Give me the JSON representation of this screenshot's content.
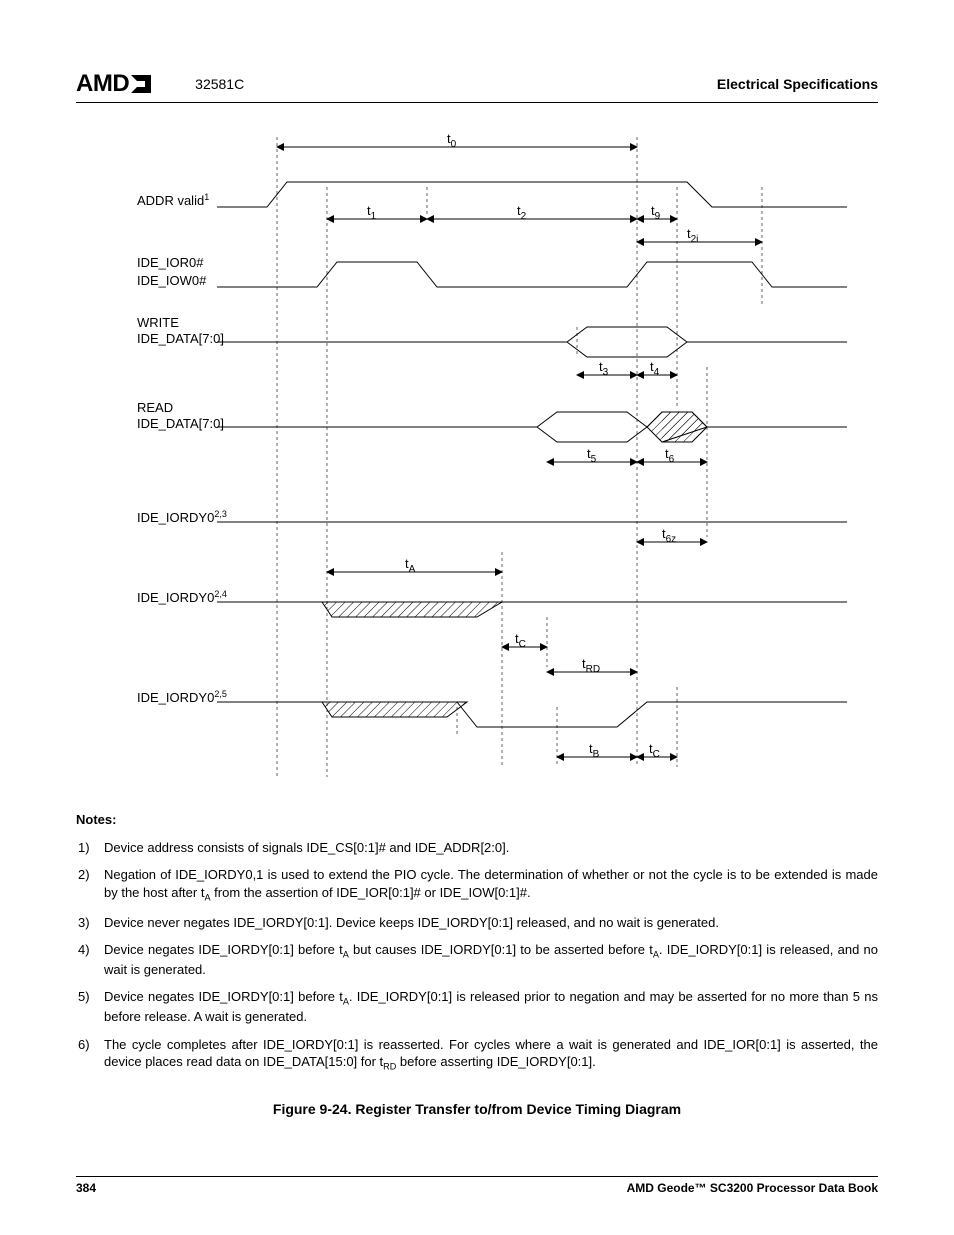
{
  "header": {
    "logo_text": "AMD",
    "doc_code": "32581C",
    "section": "Electrical Specifications"
  },
  "diagram": {
    "signals": {
      "addr": "ADDR valid",
      "addr_sup": "1",
      "ior": "IDE_IOR0#",
      "iow": "IDE_IOW0#",
      "write": "WRITE",
      "write_data": "IDE_DATA[7:0]",
      "read": "READ",
      "read_data": "IDE_DATA[7:0]",
      "iordy_a": "IDE_IORDY0",
      "iordy_a_sup": "2,3",
      "iordy_b": "IDE_IORDY0",
      "iordy_b_sup": "2,4",
      "iordy_c": "IDE_IORDY0",
      "iordy_c_sup": "2,5"
    },
    "timing": {
      "t0": "t",
      "t0_sub": "0",
      "t1": "t",
      "t1_sub": "1",
      "t2": "t",
      "t2_sub": "2",
      "t2i": "t",
      "t2i_sub": "2i",
      "t3": "t",
      "t3_sub": "3",
      "t4": "t",
      "t4_sub": "4",
      "t5": "t",
      "t5_sub": "5",
      "t6": "t",
      "t6_sub": "6",
      "t6z": "t",
      "t6z_sub": "6z",
      "t9": "t",
      "t9_sub": "9",
      "tA": "t",
      "tA_sub": "A",
      "tB": "t",
      "tB_sub": "B",
      "tC": "t",
      "tC_sub": "C",
      "tRD": "t",
      "tRD_sub": "RD"
    }
  },
  "notes": {
    "heading": "Notes:",
    "items": [
      "Device address consists of signals IDE_CS[0:1]# and IDE_ADDR[2:0].",
      "Negation of IDE_IORDY0,1 is used to extend the PIO cycle. The determination of whether or not the cycle is to be extended is made by the host after t<sub>A</sub> from the assertion of IDE_IOR[0:1]# or IDE_IOW[0:1]#.",
      "Device never negates IDE_IORDY[0:1]. Device keeps IDE_IORDY[0:1] released, and no wait is generated.",
      "Device negates IDE_IORDY[0:1] before t<sub>A</sub> but causes IDE_IORDY[0:1] to be asserted before t<sub>A</sub>. IDE_IORDY[0:1] is released, and no wait is generated.",
      "Device negates IDE_IORDY[0:1] before t<sub>A</sub>. IDE_IORDY[0:1] is released prior to negation and may be asserted for no more than 5 ns before release. A wait is generated.",
      "The cycle completes after IDE_IORDY[0:1] is reasserted. For cycles where a wait is generated and IDE_IOR[0:1] is asserted, the device places read data on IDE_DATA[15:0] for t<sub>RD</sub> before asserting IDE_IORDY[0:1]."
    ]
  },
  "figure_caption": "Figure 9-24.  Register Transfer to/from Device Timing Diagram",
  "footer": {
    "page": "384",
    "book": "AMD Geode™ SC3200 Processor Data Book"
  }
}
